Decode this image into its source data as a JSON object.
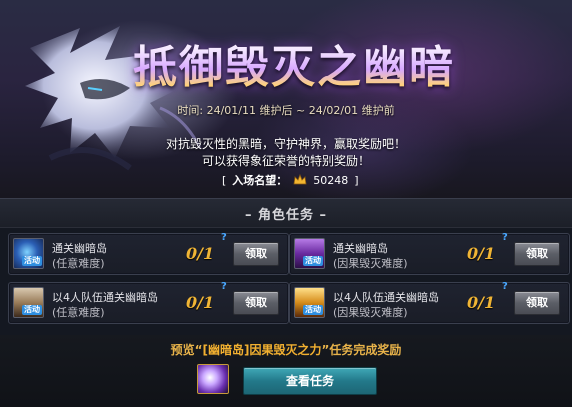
{
  "banner": {
    "title": "抵御毁灭之幽暗",
    "time": "时间: 24/01/11 维护后 ~ 24/02/01 维护前",
    "desc_line1": "对抗毁灭性的黑暗，守护神界，赢取奖励吧！",
    "desc_line2": "可以获得象征荣誉的特别奖励！",
    "reputation": {
      "open": "[",
      "label": "入场名望：",
      "icon": "crown-icon",
      "value": "50248",
      "close": "]"
    }
  },
  "section": {
    "title": "– 角色任务 –"
  },
  "tasks": [
    {
      "name": "通关幽暗岛",
      "difficulty": "(任意难度)",
      "count": "0/1",
      "help": "?",
      "button": "领取",
      "icon": "dungeon-crystal-icon",
      "tag": "活动"
    },
    {
      "name": "通关幽暗岛",
      "difficulty": "(因果毁灭难度)",
      "count": "0/1",
      "help": "?",
      "button": "领取",
      "icon": "purple-box-icon",
      "tag": "活动"
    },
    {
      "name": "以4人队伍通关幽暗岛",
      "difficulty": "(任意难度)",
      "count": "0/1",
      "help": "?",
      "button": "领取",
      "icon": "gift-box-icon",
      "tag": "活动"
    },
    {
      "name": "以4人队伍通关幽暗岛",
      "difficulty": "(因果毁灭难度)",
      "count": "0/1",
      "help": "?",
      "button": "领取",
      "icon": "gold-box-icon",
      "tag": "活动"
    }
  ],
  "reward": {
    "title_prefix": "预览“",
    "title_highlight": "[幽暗岛]因果毁灭之力",
    "title_suffix": "”任务完成奖励",
    "icon": "reward-item-icon",
    "button": "查看任务"
  }
}
